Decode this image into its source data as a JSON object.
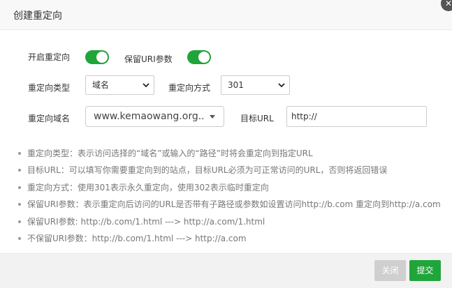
{
  "dialog": {
    "title": "创建重定向"
  },
  "form": {
    "enable_redirect": {
      "label": "开启重定向",
      "on": true
    },
    "keep_uri_params": {
      "label": "保留URI参数",
      "on": true
    },
    "redirect_type": {
      "label": "重定向类型",
      "value": "域名"
    },
    "redirect_method": {
      "label": "重定向方式",
      "value": "301"
    },
    "redirect_domain": {
      "label": "重定向域名",
      "value": "www.kemaowang.org..."
    },
    "target_url": {
      "label": "目标URL",
      "value": "http://"
    }
  },
  "notes": [
    "重定向类型：表示访问选择的“域名”或输入的“路径”时将会重定向到指定URL",
    "目标URL：可以填写你需要重定向到的站点，目标URL必须为可正常访问的URL，否则将返回错误",
    "重定向方式：使用301表示永久重定向，使用302表示临时重定向",
    "保留URI参数：表示重定向后访问的URL是否带有子路径或参数如设置访问http://b.com 重定向到http://a.com",
    "保留URI参数:  http://b.com/1.html ---> http://a.com/1.html",
    "不保留URI参数：http://b.com/1.html ---> http://a.com"
  ],
  "footer": {
    "close_label": "关闭",
    "submit_label": "提交"
  },
  "colors": {
    "accent": "#20a53a",
    "disabled": "#cfcfcf"
  }
}
